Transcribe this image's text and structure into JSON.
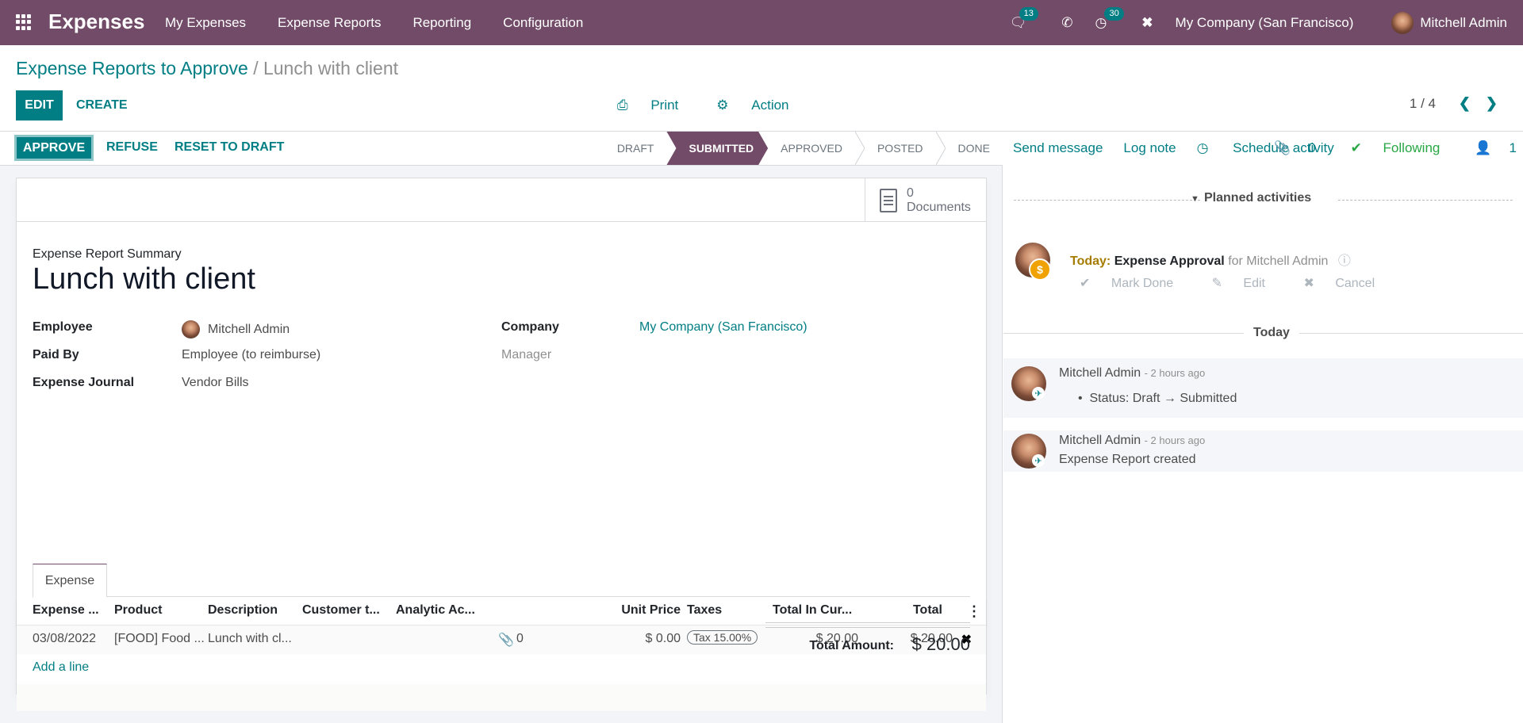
{
  "navbar": {
    "app_name": "Expenses",
    "menu": [
      "My Expenses",
      "Expense Reports",
      "Reporting",
      "Configuration"
    ],
    "messages_count": "13",
    "activities_count": "30",
    "company": "My Company (San Francisco)",
    "user": "Mitchell Admin",
    "icons": [
      "apps-grid-icon",
      "chat-icon",
      "phone-icon",
      "clock-icon",
      "tools-icon"
    ]
  },
  "control_panel": {
    "breadcrumb_parent": "Expense Reports to Approve",
    "breadcrumb_sep": "/",
    "breadcrumb_current": "Lunch with client",
    "edit_label": "EDIT",
    "create_label": "CREATE",
    "print_label": "Print",
    "action_label": "Action",
    "pager": "1 / 4"
  },
  "statusbar": {
    "buttons": [
      "APPROVE",
      "REFUSE",
      "RESET TO DRAFT"
    ],
    "stages": [
      "DRAFT",
      "SUBMITTED",
      "APPROVED",
      "POSTED",
      "DONE"
    ],
    "active_stage": "SUBMITTED"
  },
  "sheet": {
    "documents_count": "0",
    "documents_label": "Documents",
    "summary_label": "Expense Report Summary",
    "title": "Lunch with client",
    "fields": {
      "employee_label": "Employee",
      "employee_value": "Mitchell Admin",
      "paid_by_label": "Paid By",
      "paid_by_value": "Employee (to reimburse)",
      "journal_label": "Expense Journal",
      "journal_value": "Vendor Bills",
      "company_label": "Company",
      "company_value": "My Company (San Francisco)",
      "manager_label": "Manager"
    },
    "tab": "Expense",
    "table": {
      "headers": [
        "Expense ...",
        "Product",
        "Description",
        "Customer t...",
        "Analytic Ac...",
        "Unit Price",
        "Taxes",
        "Total In Cur...",
        "Total"
      ],
      "rows": [
        {
          "date": "03/08/2022",
          "product": "[FOOD] Food ...",
          "description": "Lunch with cl...",
          "customer": "",
          "analytic": "",
          "attachments": "0",
          "unit_price": "$ 0.00",
          "taxes": "Tax 15.00%",
          "total_currency": "$ 20.00",
          "total": "$ 20.00"
        }
      ],
      "add_line": "Add a line"
    },
    "total_label": "Total Amount:",
    "total_value": "$ 20.00"
  },
  "chatter": {
    "send_message": "Send message",
    "log_note": "Log note",
    "schedule_activity": "Schedule activity",
    "attachments_count": "0",
    "following": "Following",
    "followers_count": "1",
    "planned_label": "Planned activities",
    "activity": {
      "when": "Today:",
      "name": "Expense Approval",
      "for": "for Mitchell Admin",
      "mark_done": "Mark Done",
      "edit": "Edit",
      "cancel": "Cancel"
    },
    "date_separator": "Today",
    "messages": [
      {
        "author": "Mitchell Admin",
        "time": "- 2 hours ago",
        "body": "Status: Draft → Submitted"
      },
      {
        "author": "Mitchell Admin",
        "time": "- 2 hours ago",
        "body": "Expense Report created"
      }
    ]
  },
  "colors": {
    "brand": "#714b67",
    "primary": "#017e84",
    "activity_today": "#a67c00",
    "activity_badge": "#f0a202"
  }
}
